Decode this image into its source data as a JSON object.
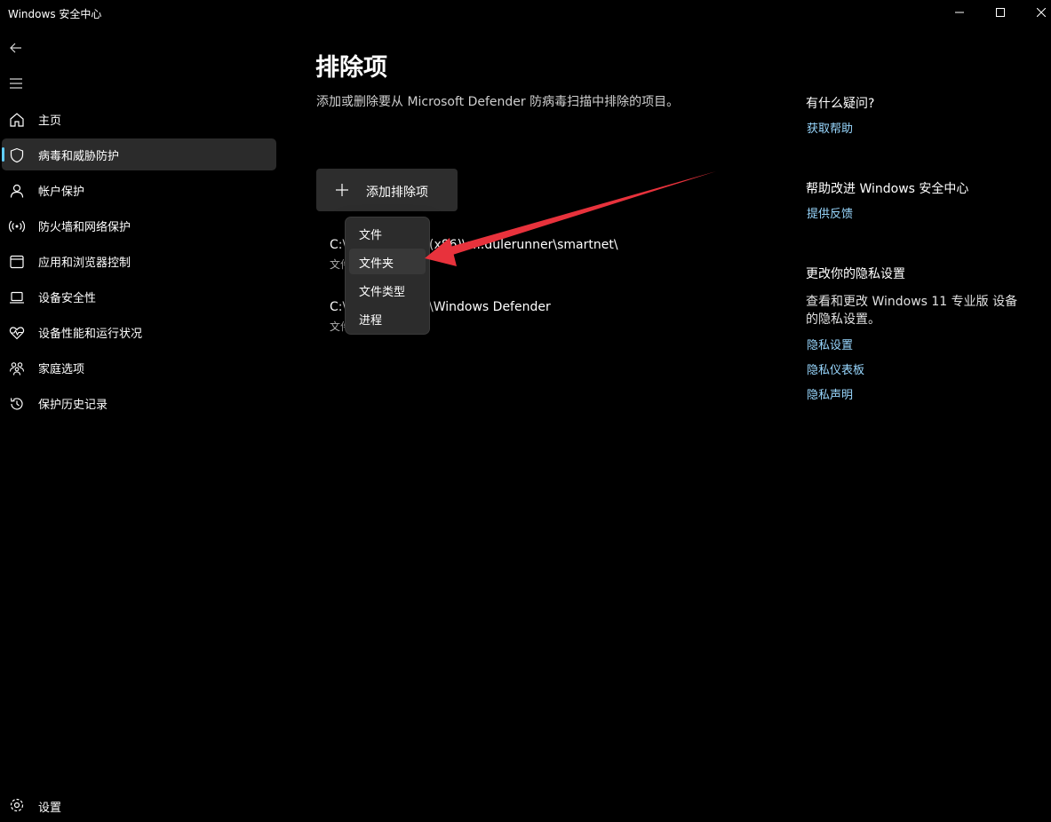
{
  "window": {
    "title": "Windows 安全中心"
  },
  "sidebar": {
    "items": [
      {
        "label": "主页",
        "icon": "home-icon"
      },
      {
        "label": "病毒和威胁防护",
        "icon": "shield-icon",
        "active": true
      },
      {
        "label": "帐户保护",
        "icon": "person-icon"
      },
      {
        "label": "防火墙和网络保护",
        "icon": "wireless-icon"
      },
      {
        "label": "应用和浏览器控制",
        "icon": "browser-window-icon"
      },
      {
        "label": "设备安全性",
        "icon": "laptop-icon"
      },
      {
        "label": "设备性能和运行状况",
        "icon": "heart-pulse-icon"
      },
      {
        "label": "家庭选项",
        "icon": "family-icon"
      },
      {
        "label": "保护历史记录",
        "icon": "history-icon"
      }
    ],
    "settings_label": "设置"
  },
  "main": {
    "title": "排除项",
    "description": "添加或删除要从 Microsoft Defender 防病毒扫描中排除的项目。",
    "add_button_label": "添加排除项",
    "exclusions": [
      {
        "path": "C:\\Program Files (x86)\\scheduler runner\\smartnet\\",
        "path_visible_left": "C:\\",
        "path_visible_right": "(x86)\\s...dulerunner\\smartnet\\",
        "type_visible": "文件"
      },
      {
        "path_visible_left": "C:\\",
        "path_visible_right": "\\Windows Defender",
        "type_visible": "文件"
      }
    ]
  },
  "dropdown_menu": {
    "items": [
      "文件",
      "文件夹",
      "文件类型",
      "进程"
    ],
    "hovered_index": 1
  },
  "right_panel": {
    "help_heading": "有什么疑问?",
    "help_link": "获取帮助",
    "improve_heading": "帮助改进 Windows 安全中心",
    "feedback_link": "提供反馈",
    "privacy_heading": "更改你的隐私设置",
    "privacy_text": "查看和更改 Windows 11 专业版 设备的隐私设置。",
    "privacy_links": [
      "隐私设置",
      "隐私仪表板",
      "隐私声明"
    ]
  },
  "colors": {
    "background": "#000000",
    "accent": "#60cdff",
    "link": "#99d8ff",
    "annotation_arrow": "#e8323c"
  }
}
